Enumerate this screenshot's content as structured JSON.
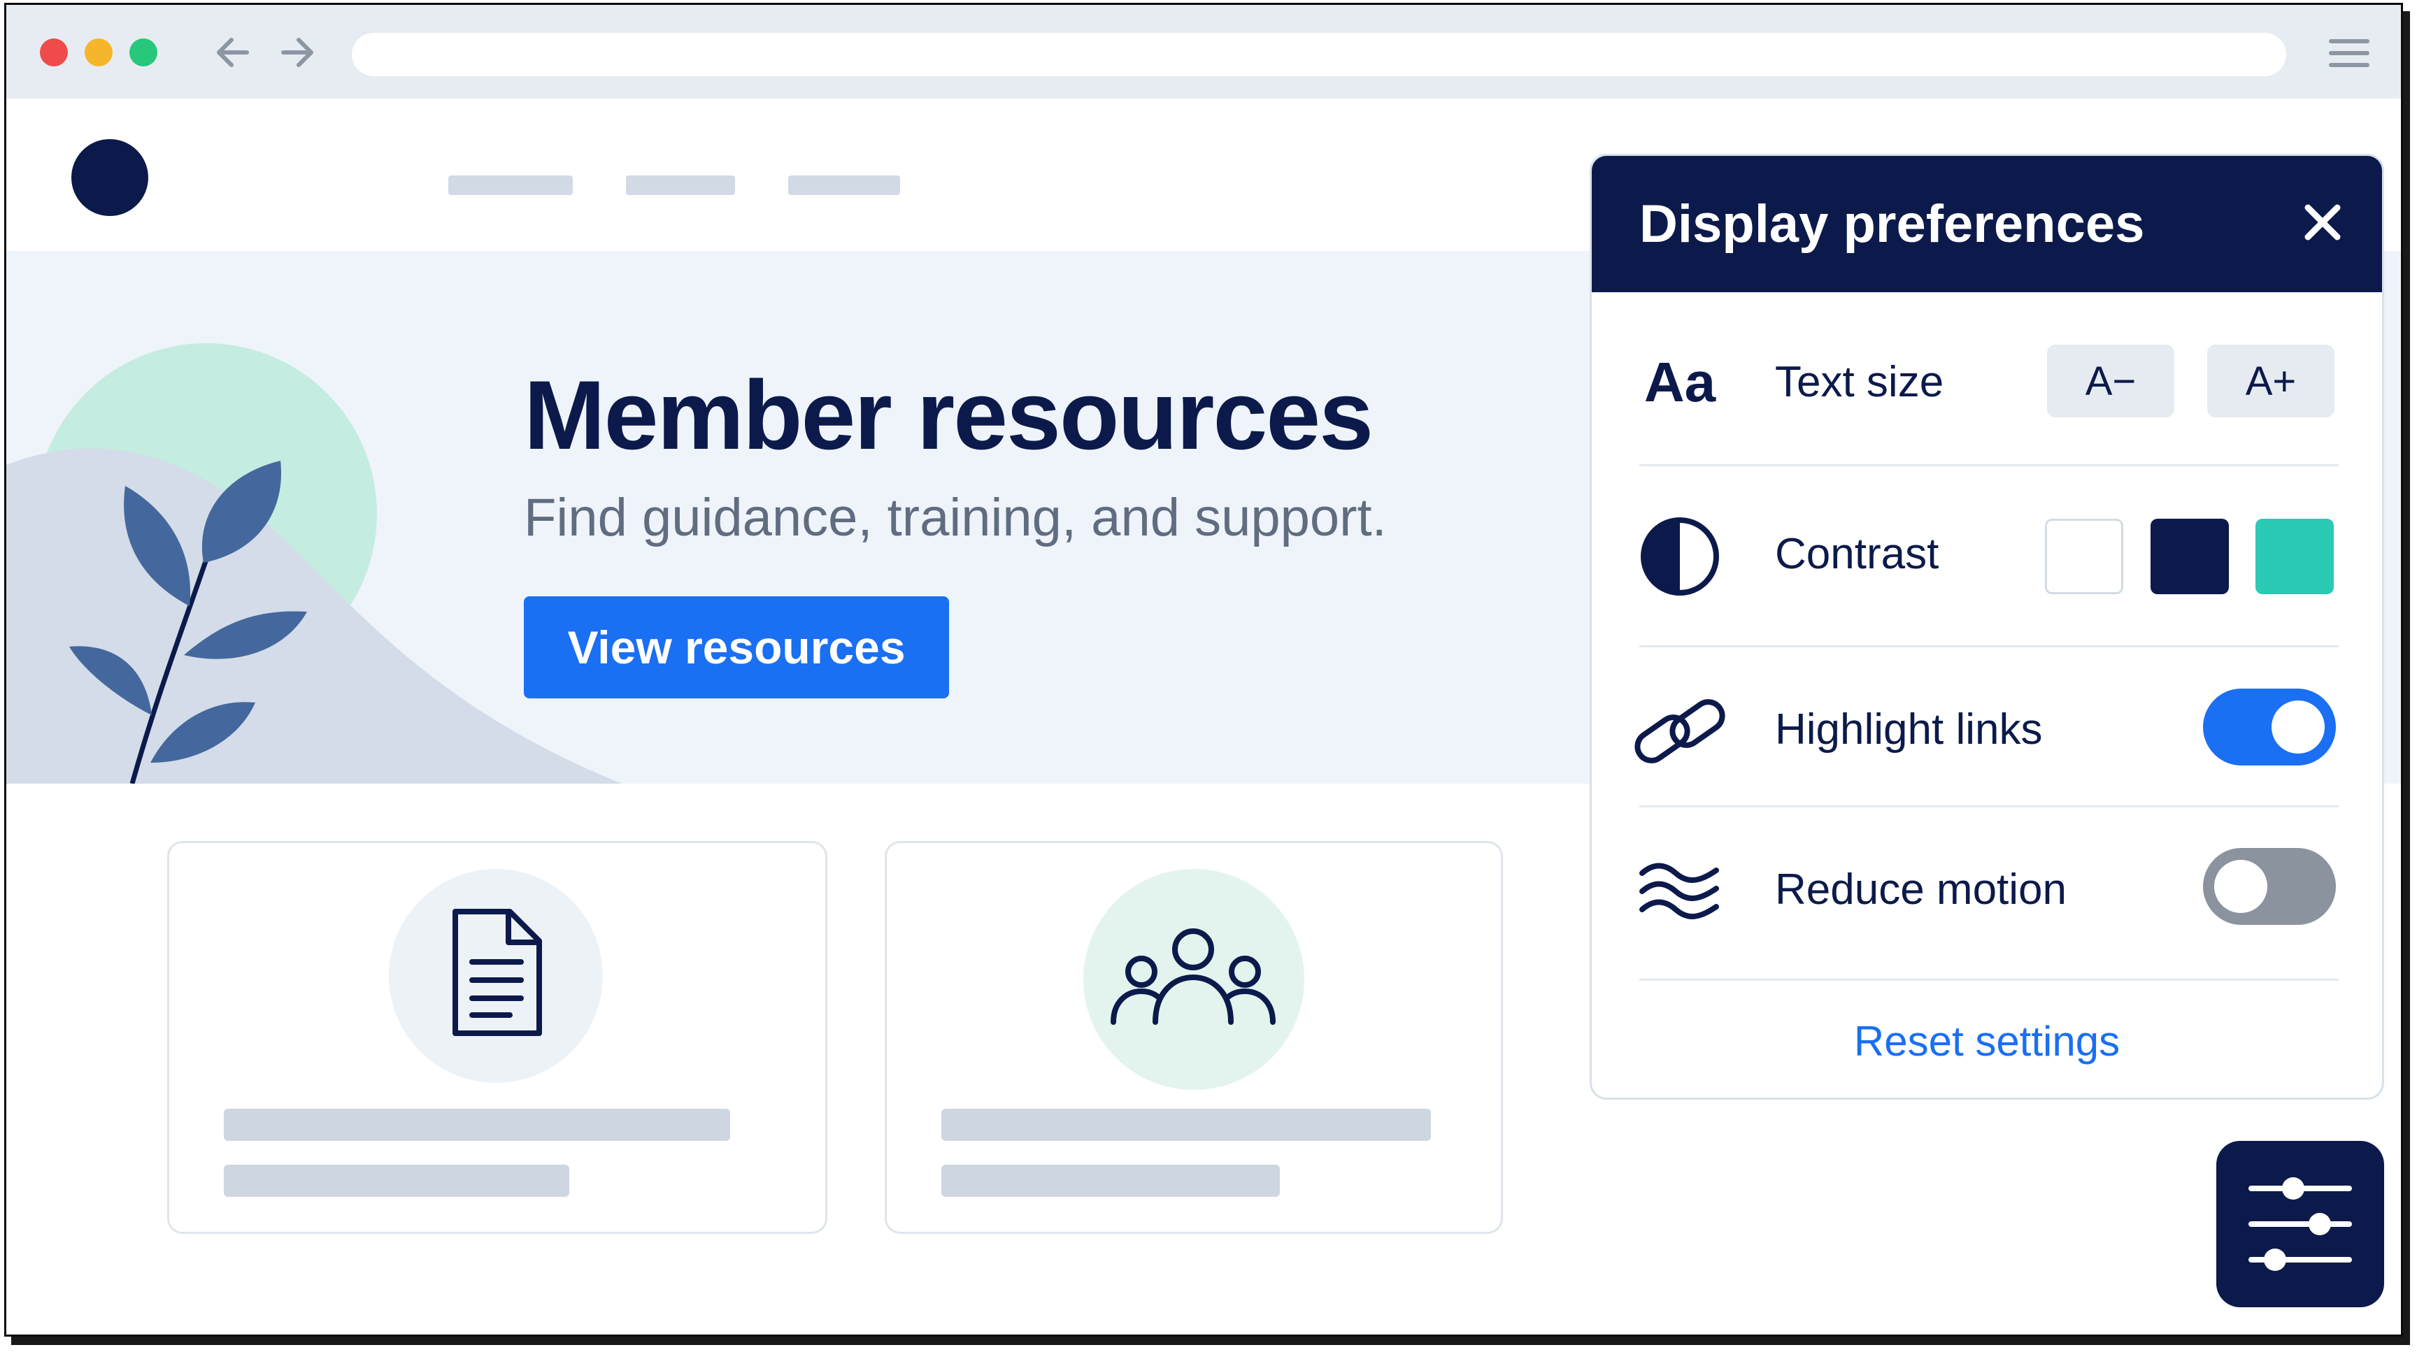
{
  "colors": {
    "navy": "#0c1a4b",
    "accent_blue": "#1a6ff2",
    "teal": "#2bcab5",
    "toggle_off": "#8b939e",
    "hero_bg": "#eef4f9"
  },
  "browser": {
    "icons": [
      "close-dot",
      "minimize-dot",
      "maximize-dot",
      "back-arrow-icon",
      "forward-arrow-icon",
      "hamburger-menu-icon"
    ]
  },
  "hero": {
    "title": "Member resources",
    "subtitle": "Find guidance, training, and support.",
    "cta_label": "View resources"
  },
  "cards": [
    {
      "icon": "document-icon"
    },
    {
      "icon": "people-icon"
    }
  ],
  "panel": {
    "title": "Display preferences",
    "text_size": {
      "icon_text": "Aa",
      "label": "Text size",
      "decrease_label": "A−",
      "increase_label": "A+"
    },
    "contrast": {
      "label": "Contrast",
      "swatches": [
        "#ffffff",
        "#0c1a4b",
        "#2bcab5"
      ]
    },
    "highlight_links": {
      "label": "Highlight links",
      "enabled": true
    },
    "reduce_motion": {
      "label": "Reduce motion",
      "enabled": false
    },
    "reset_label": "Reset settings"
  },
  "fab": {
    "icon": "sliders-icon"
  }
}
